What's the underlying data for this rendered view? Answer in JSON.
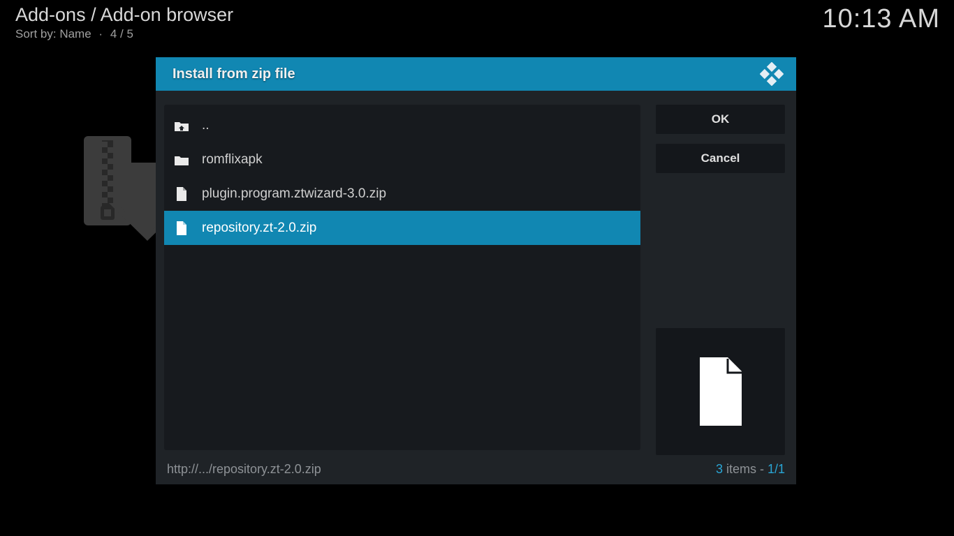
{
  "header": {
    "breadcrumb": "Add-ons / Add-on browser",
    "sort_label": "Sort by:",
    "sort_value": "Name",
    "position": "4 / 5",
    "clock": "10:13 AM"
  },
  "dialog": {
    "title": "Install from zip file"
  },
  "files": [
    {
      "icon": "folder-up",
      "label": ".."
    },
    {
      "icon": "folder",
      "label": "romflixapk"
    },
    {
      "icon": "file",
      "label": "plugin.program.ztwizard-3.0.zip"
    },
    {
      "icon": "file",
      "label": "repository.zt-2.0.zip",
      "selected": true
    }
  ],
  "buttons": {
    "ok": "OK",
    "cancel": "Cancel"
  },
  "footer": {
    "path": "http://.../repository.zt-2.0.zip",
    "count_num": "3",
    "count_label": " items - ",
    "page": "1/1"
  }
}
